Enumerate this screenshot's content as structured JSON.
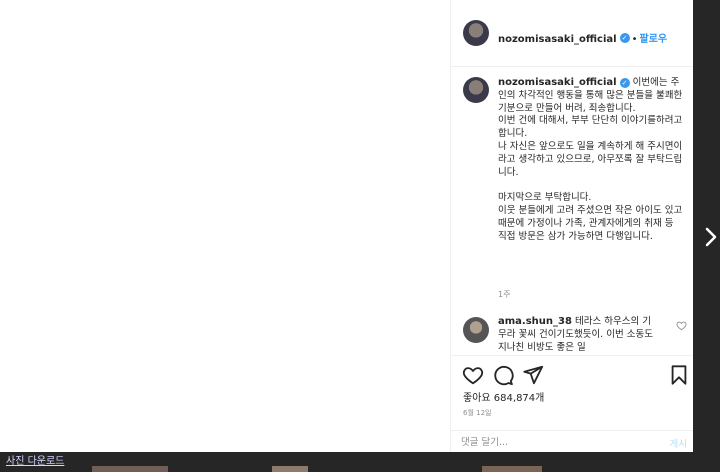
{
  "post": {
    "author": "nozomisasaki_official",
    "verified_mark": "✓",
    "separator": "•",
    "follow_label": "팔로우",
    "caption": "이번에는 주인의 차각적인 행동을 통해 많은 분들을 불쾌한 기분으로 만들어 버려, 죄송합니다.\n이번 건에 대해서, 부부 단단히 이야기를하려고합니다.\n나 자신은 앞으로도 일을 계속하게 해 주시면이라고 생각하고 있으므로, 아무쪼록 잘 부탁드립니다.\n\n마지막으로 부탁합니다.\n이웃 분들에게 고려 주셨으면 작은 아이도 있고 때문에 가정이나 가족, 관계자에게의 취재 등 직접 방문은 삼가 가능하면 다행입니다.",
    "caption_time": "1주",
    "comment": {
      "author": "ama.shun_38",
      "text": "테라스 하우스의 기무라 꽃씨 건이기도했듯이. 이번 소동도 지나친 비방도 좋은 일"
    },
    "likes_label": "좋아요",
    "likes_count": "684,874개",
    "date": "6월 12일",
    "comment_placeholder": "댓글 달기...",
    "post_button": "게시"
  },
  "download_link": "사진 다운로드",
  "icons": [
    "heart-icon",
    "comment-icon",
    "share-icon",
    "bookmark-icon",
    "next-arrow-icon"
  ],
  "colors": {
    "accent": "#3897f0",
    "backdrop": "#262626",
    "border": "#efefef",
    "muted": "#8e8e8e"
  }
}
